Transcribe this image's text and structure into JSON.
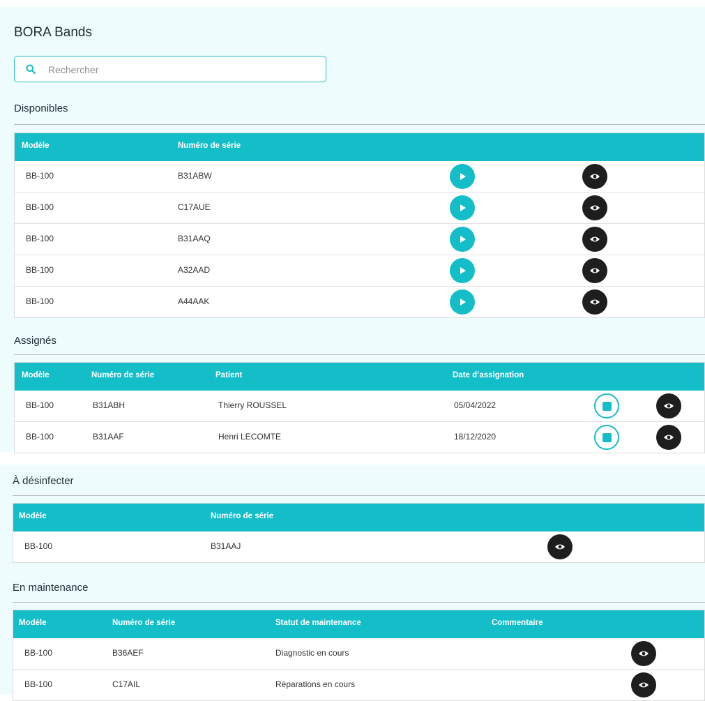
{
  "app": {
    "title": "BORA Bands"
  },
  "search": {
    "placeholder": "Rechercher",
    "value": ""
  },
  "colors": {
    "accent": "#14bec8",
    "dark_button": "#1e1e1e",
    "panel_bg": "#eefcfe"
  },
  "disponibles": {
    "title": "Disponibles",
    "columns": [
      "Modèle",
      "Numéro de série"
    ],
    "rows": [
      {
        "modele": "BB-100",
        "serie": "B31ABW"
      },
      {
        "modele": "BB-100",
        "serie": "C17AUE"
      },
      {
        "modele": "BB-100",
        "serie": "B31AAQ"
      },
      {
        "modele": "BB-100",
        "serie": "A32AAD"
      },
      {
        "modele": "BB-100",
        "serie": "A44AAK"
      }
    ],
    "actions": [
      "play-icon",
      "eye-icon"
    ]
  },
  "assignes": {
    "title": "Assignés",
    "columns": [
      "Modèle",
      "Numéro de série",
      "Patient",
      "Date d’assignation"
    ],
    "rows": [
      {
        "modele": "BB-100",
        "serie": "B31ABH",
        "patient": "Thierry ROUSSEL",
        "date": "05/04/2022"
      },
      {
        "modele": "BB-100",
        "serie": "B31AAF",
        "patient": "Henri LECOMTE",
        "date": "18/12/2020"
      }
    ],
    "actions": [
      "stop-icon",
      "eye-icon"
    ]
  },
  "a_desinfecter": {
    "title": "À désinfecter",
    "columns": [
      "Modèle",
      "Numéro de série"
    ],
    "rows": [
      {
        "modele": "BB-100",
        "serie": "B31AAJ"
      }
    ],
    "actions": [
      "eye-icon"
    ]
  },
  "maintenance": {
    "title": "En maintenance",
    "columns": [
      "Modèle",
      "Numéro de série",
      "Statut de maintenance",
      "Commentaire"
    ],
    "rows": [
      {
        "modele": "BB-100",
        "serie": "B36AEF",
        "statut": "Diagnostic en cours",
        "commentaire": ""
      },
      {
        "modele": "BB-100",
        "serie": "C17AIL",
        "statut": "Réparations en cours",
        "commentaire": ""
      }
    ],
    "actions": [
      "eye-icon"
    ]
  }
}
